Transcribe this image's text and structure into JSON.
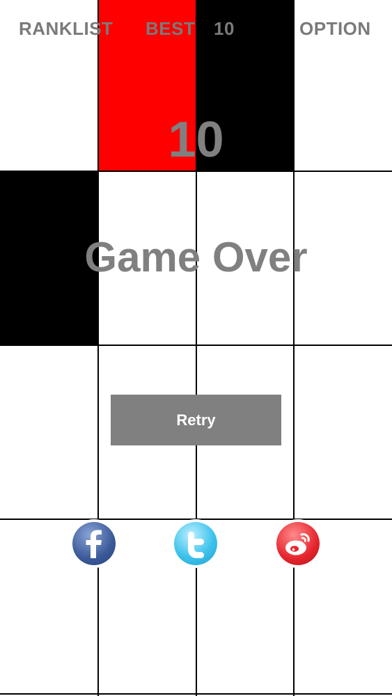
{
  "header": {
    "ranklist_label": "RANKLIST",
    "best_label": "BEST",
    "best_value": "10",
    "option_label": "OPTION"
  },
  "game": {
    "score": "10",
    "status": "Game Over"
  },
  "actions": {
    "retry_label": "Retry"
  },
  "share": [
    "facebook-icon",
    "twitter-icon",
    "weibo-icon"
  ],
  "colors": {
    "tile_red": "#ff0000",
    "tile_black": "#000000",
    "text_gray": "#808080",
    "button_gray": "#808080"
  }
}
